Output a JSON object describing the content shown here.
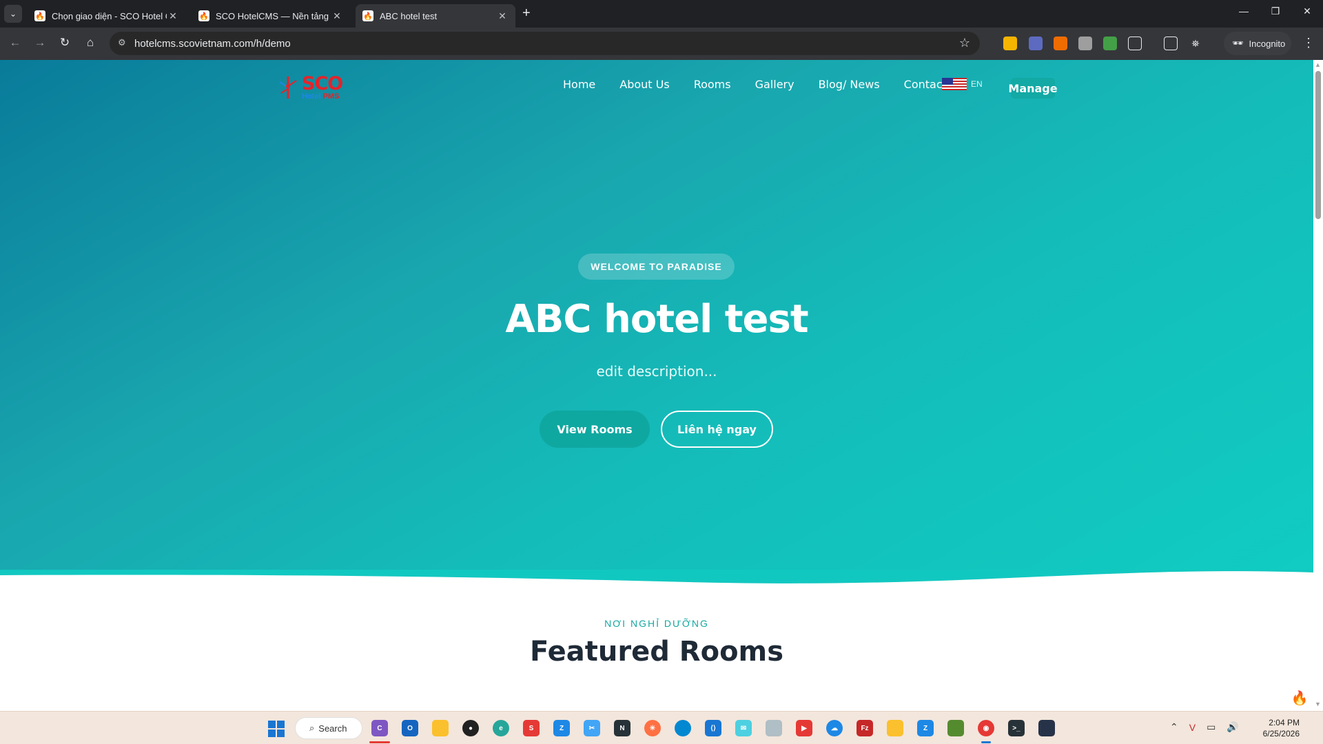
{
  "browser": {
    "tabs": [
      {
        "title": "Chọn giao diện - SCO Hotel CMS"
      },
      {
        "title": "SCO HotelCMS — Nền tảng website"
      },
      {
        "title": "ABC hotel test"
      }
    ],
    "url": "hotelcms.scovietnam.com/h/demo",
    "incognito_label": "Incognito"
  },
  "site": {
    "logo": {
      "brand": "SCO",
      "sub1": "Hotel",
      "sub2": "PMS"
    },
    "nav": [
      "Home",
      "About Us",
      "Rooms",
      "Gallery",
      "Blog/ News",
      "Contact"
    ],
    "language": "EN",
    "manage_label": "Manage",
    "hero": {
      "badge": "WELCOME TO PARADISE",
      "title": "ABC hotel test",
      "description": "edit description...",
      "btn_primary": "View Rooms",
      "btn_secondary": "Liên hệ ngay"
    },
    "section": {
      "kicker": "NƠI NGHỈ DƯỠNG",
      "title": "Featured Rooms"
    },
    "colors": {
      "hero_start": "#097b9a",
      "hero_end": "#10cdc3",
      "accent": "#13a8a2"
    }
  },
  "taskbar": {
    "search_label": "Search",
    "time": "2:04 PM",
    "date": "6/25/2026"
  }
}
